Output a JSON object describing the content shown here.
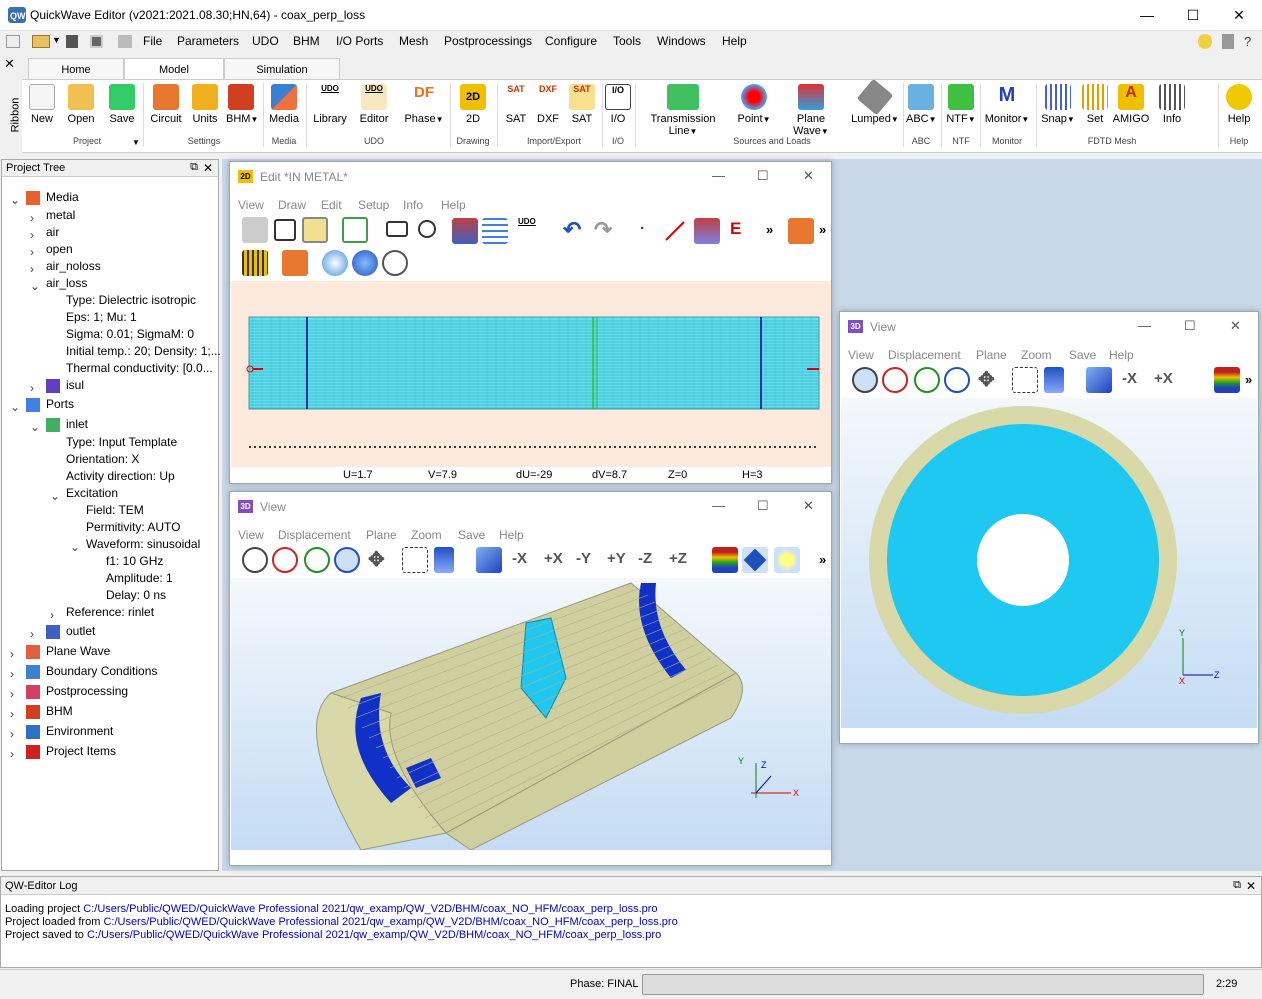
{
  "app": {
    "title": "QuickWave Editor (v2021:2021.08.30;HN,64) - coax_perp_loss"
  },
  "menu": [
    "File",
    "Parameters",
    "UDO",
    "BHM",
    "I/O Ports",
    "Mesh",
    "Postprocessings",
    "Configure",
    "Tools",
    "Windows",
    "Help"
  ],
  "ribbon_tabs": [
    "Home",
    "Model",
    "Simulation"
  ],
  "ribbon_side": "Ribbon",
  "ribbon": {
    "buttons": [
      "New",
      "Open",
      "Save",
      "Circuit",
      "Units",
      "BHM",
      "Media",
      "Library",
      "Editor",
      "Phase",
      "2D",
      "SAT",
      "DXF",
      "SAT",
      "I/O",
      "Transmission Line",
      "Point",
      "Plane Wave",
      "Lumped",
      "ABC",
      "NTF",
      "Monitor",
      "Snap",
      "Set",
      "AMIGO",
      "Info",
      "Help"
    ],
    "groups": [
      "Project",
      "Settings",
      "Media",
      "UDO",
      "Drawing",
      "Import/Export",
      "I/O",
      "Sources and Loads",
      "ABC",
      "NTF",
      "Monitor",
      "FDTD Mesh",
      "Help"
    ],
    "icon_texts": {
      "udo": "UDO",
      "df": "DF",
      "twod": "2D",
      "sat": "SAT",
      "dxf": "DXF",
      "io": "I/O",
      "m": "M",
      "amigo": "A"
    }
  },
  "tree": {
    "title": "Project Tree",
    "items": [
      "Media",
      "metal",
      "air",
      "open",
      "air_noloss",
      "air_loss",
      "Type: Dielectric isotropic",
      "Eps: 1; Mu: 1",
      "Sigma: 0.01; SigmaM: 0",
      "Initial temp.: 20; Density: 1;...",
      "Thermal conductivity: [0.0...",
      "isul",
      "Ports",
      "inlet",
      "Type: Input Template",
      "Orientation: X",
      "Activity direction: Up",
      "Excitation",
      "Field: TEM",
      "Permitivity: AUTO",
      "Waveform: sinusoidal",
      "f1: 10 GHz",
      "Amplitude: 1",
      "Delay: 0 ns",
      "Reference: rinlet",
      "outlet",
      "Plane Wave",
      "Boundary Conditions",
      "Postprocessing",
      "BHM",
      "Environment",
      "Project Items"
    ]
  },
  "edit_window": {
    "badge": "2D",
    "title": "Edit   *IN METAL*",
    "menu": [
      "View",
      "Draw",
      "Edit",
      "Setup",
      "Info",
      "Help"
    ],
    "icon_text": "E",
    "status": [
      "U=1.7",
      "V=7.9",
      "dU=-29",
      "dV=8.7",
      "Z=0",
      "H=3"
    ]
  },
  "view3d": {
    "badge": "3D",
    "title": "View",
    "menu": [
      "View",
      "Displacement",
      "Plane",
      "Zoom",
      "Save",
      "Help"
    ],
    "buttons": [
      "-X",
      "+X",
      "-Y",
      "+Y",
      "-Z",
      "+Z"
    ],
    "axes": [
      "X",
      "Y",
      "Z"
    ]
  },
  "view_right": {
    "badge": "3D",
    "title": "View",
    "menu": [
      "View",
      "Displacement",
      "Plane",
      "Zoom",
      "Save",
      "Help"
    ],
    "buttons": [
      "-X",
      "+X"
    ],
    "axes": [
      "Y",
      "Z",
      "X"
    ]
  },
  "log": {
    "title": "QW-Editor Log",
    "lines": [
      {
        "prefix": "Loading project ",
        "path": "C:/Users/Public/QWED/QuickWave Professional 2021/qw_examp/QW_V2D/BHM/coax_NO_HFM/coax_perp_loss.pro"
      },
      {
        "prefix": "Project loaded from ",
        "path": "C:/Users/Public/QWED/QuickWave Professional 2021/qw_examp/QW_V2D/BHM/coax_NO_HFM/coax_perp_loss.pro"
      },
      {
        "prefix": "Project saved to ",
        "path": "C:/Users/Public/QWED/QuickWave Professional 2021/qw_examp/QW_V2D/BHM/coax_NO_HFM/coax_perp_loss.pro"
      }
    ]
  },
  "status": {
    "phase": "Phase: FINAL",
    "time": "2:29"
  },
  "colors": {
    "accent": "#0078d7",
    "cyan": "#1ec8f0",
    "ring": "#d8d8a8",
    "deepblue": "#1030c8",
    "bg3d": "#dcebf8"
  }
}
